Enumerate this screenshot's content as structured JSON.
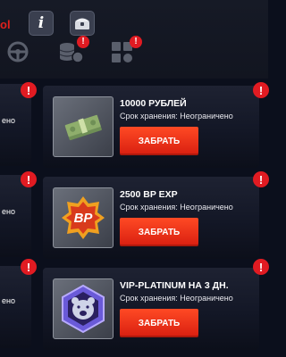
{
  "header": {
    "logo_fragment": "ol",
    "info_button": "i",
    "nav_badge": "!",
    "colors": {
      "accent": "#e0201c",
      "badge": "#e11b22",
      "button": "#ef3a1c"
    }
  },
  "left_column": {
    "cards": [
      {
        "text": "ено"
      },
      {
        "text": "ено"
      },
      {
        "text": "ено"
      }
    ]
  },
  "rewards": [
    {
      "title": "10000 РУБЛЕЙ",
      "subtitle": "Срок хранения: Неограничено",
      "button": "ЗАБРАТЬ",
      "badge": "!",
      "icon": "money-bundle-icon"
    },
    {
      "title": "2500 BP EXP",
      "subtitle": "Срок хранения: Неограничено",
      "button": "ЗАБРАТЬ",
      "badge": "!",
      "icon": "bp-badge-icon",
      "icon_text": "BP"
    },
    {
      "title": "VIP-PLATINUM НА 3 ДН.",
      "subtitle": "Срок хранения: Неограничено",
      "button": "ЗАБРАТЬ",
      "badge": "!",
      "icon": "bear-emblem-icon"
    }
  ],
  "card_badge": "!"
}
